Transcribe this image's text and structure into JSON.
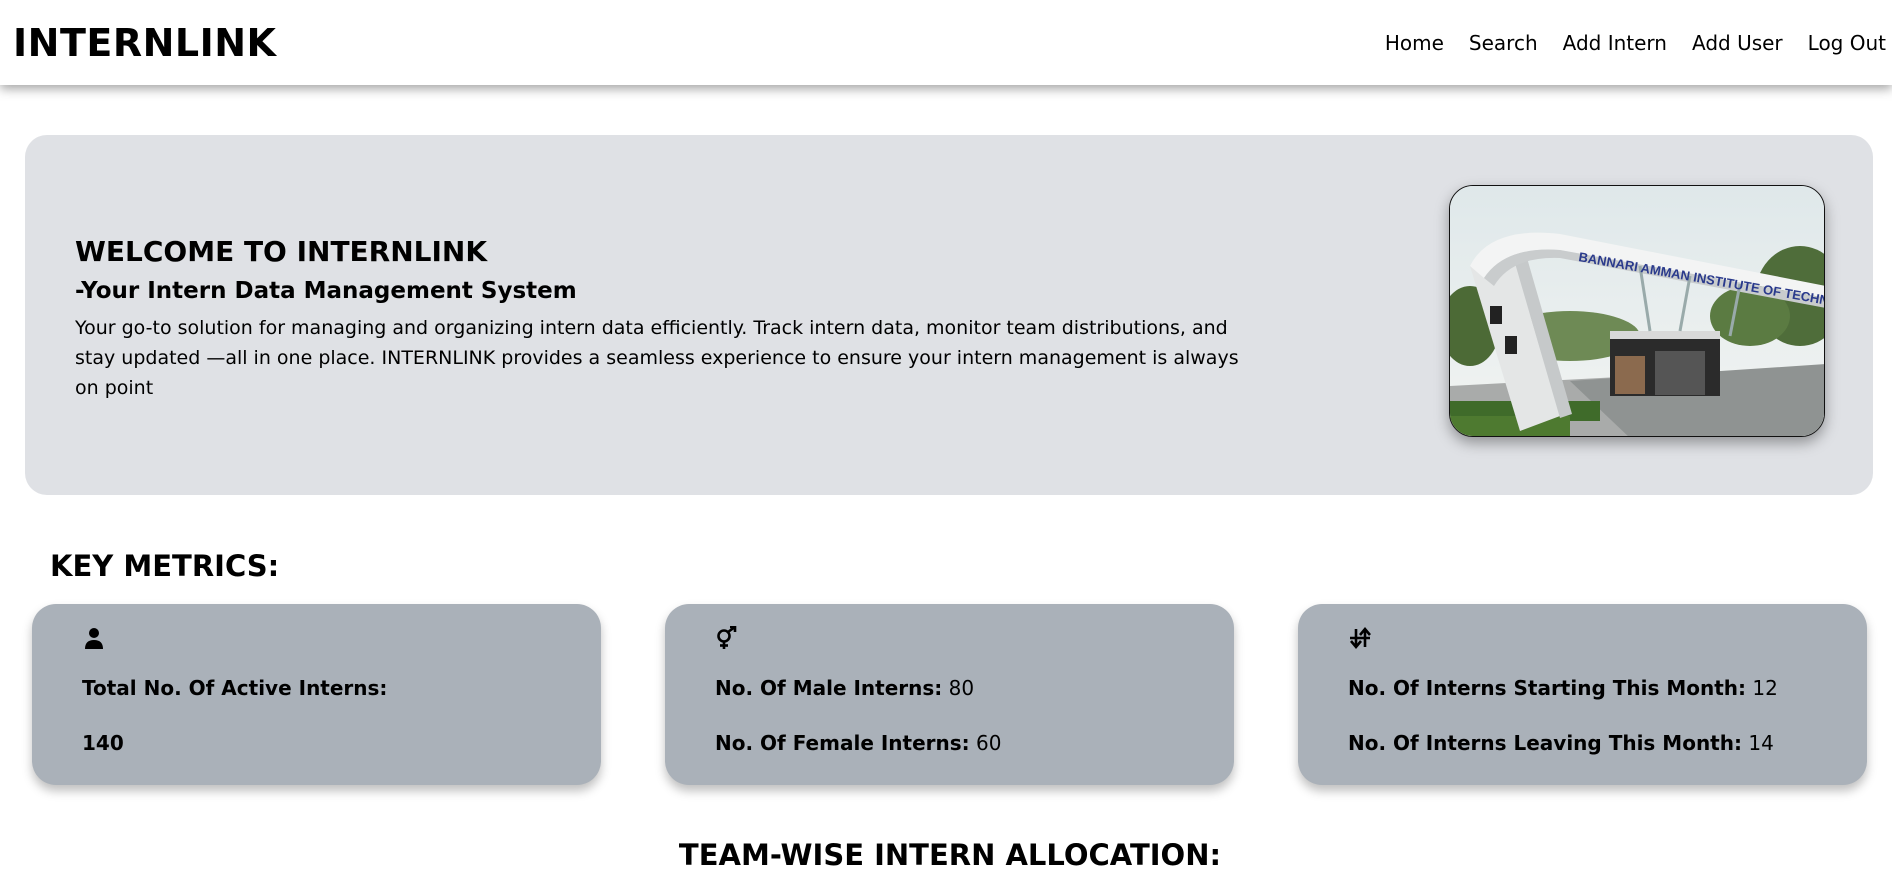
{
  "navbar": {
    "brand": "INTERNLINK",
    "links": [
      "Home",
      "Search",
      "Add Intern",
      "Add User",
      "Log Out"
    ]
  },
  "hero": {
    "title": "WELCOME TO INTERNLINK",
    "subtitle": "-Your Intern Data Management System",
    "description": "Your go-to solution for managing and organizing intern data efficiently. Track intern data, monitor team distributions, and stay updated —all in one place. INTERNLINK provides a seamless experience to ensure your intern management is always on point",
    "image_sign_text": "BANNARI AMMAN INSTITUTE OF TECHNOLOGY"
  },
  "metrics": {
    "title": "KEY METRICS:",
    "cards": [
      {
        "icon": "user-icon",
        "lines": [
          {
            "label": "Total No. Of Active Interns:",
            "value": ""
          },
          {
            "label": "",
            "value": "140"
          }
        ]
      },
      {
        "icon": "gender-icon",
        "lines": [
          {
            "label": "No. Of Male Interns:",
            "value": "80"
          },
          {
            "label": "No. Of Female Interns:",
            "value": "60"
          }
        ]
      },
      {
        "icon": "arrows-exchange-icon",
        "lines": [
          {
            "label": "No. Of Interns Starting This Month:",
            "value": "12"
          },
          {
            "label": "No. Of Interns Leaving This Month:",
            "value": "14"
          }
        ]
      }
    ]
  },
  "team": {
    "title": "TEAM-WISE INTERN ALLOCATION:"
  }
}
